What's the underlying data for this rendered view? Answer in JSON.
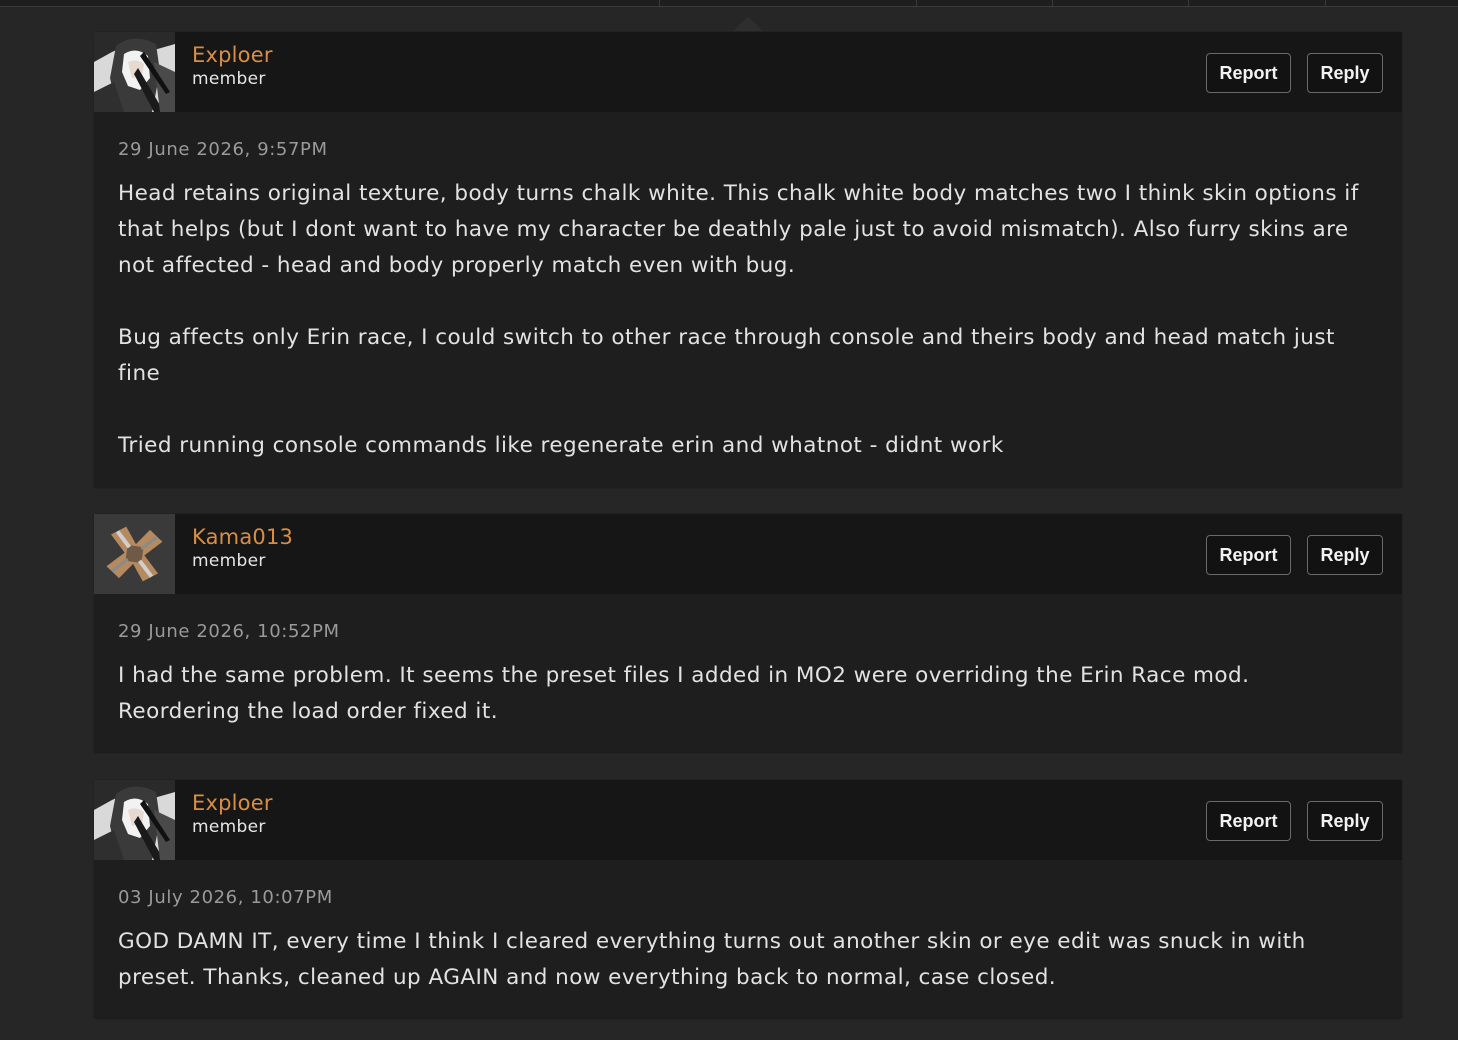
{
  "comments": [
    {
      "author": "Exploer",
      "role": "member",
      "avatar": "anime-character-avatar",
      "report_label": "Report",
      "reply_label": "Reply",
      "timestamp": "29 June 2026, 9:57PM",
      "paragraphs": [
        "Head retains original texture, body turns chalk white. This chalk white body matches two I think skin options if that helps (but I dont want to have my character be deathly pale just to avoid mismatch). Also furry skins are not affected - head and body properly match even with bug.",
        "Bug affects only Erin race, I could switch to other race through console and theirs body and head match just fine",
        "Tried running console commands like regenerate erin and whatnot - didnt work"
      ]
    },
    {
      "author": "Kama013",
      "role": "member",
      "avatar": "default-avatar-icon",
      "report_label": "Report",
      "reply_label": "Reply",
      "timestamp": "29 June 2026, 10:52PM",
      "paragraphs": [
        "I had the same problem. It seems the preset files I added in MO2 were overriding the Erin Race mod. Reordering the load order fixed it."
      ]
    },
    {
      "author": "Exploer",
      "role": "member",
      "avatar": "anime-character-avatar",
      "report_label": "Report",
      "reply_label": "Reply",
      "timestamp": "03 July 2026, 10:07PM",
      "paragraphs": [
        "GOD DAMN IT, every time I think I cleared everything turns out another skin or eye edit was snuck in with preset. Thanks, cleaned up AGAIN and now everything back to normal, case closed."
      ]
    }
  ],
  "colors": {
    "page_background": "#262626",
    "card_background": "#1e1e1e",
    "header_background": "#161616",
    "author_name": "#d98e43",
    "timestamp": "#9a9a9a",
    "text": "#e2e2e2"
  }
}
